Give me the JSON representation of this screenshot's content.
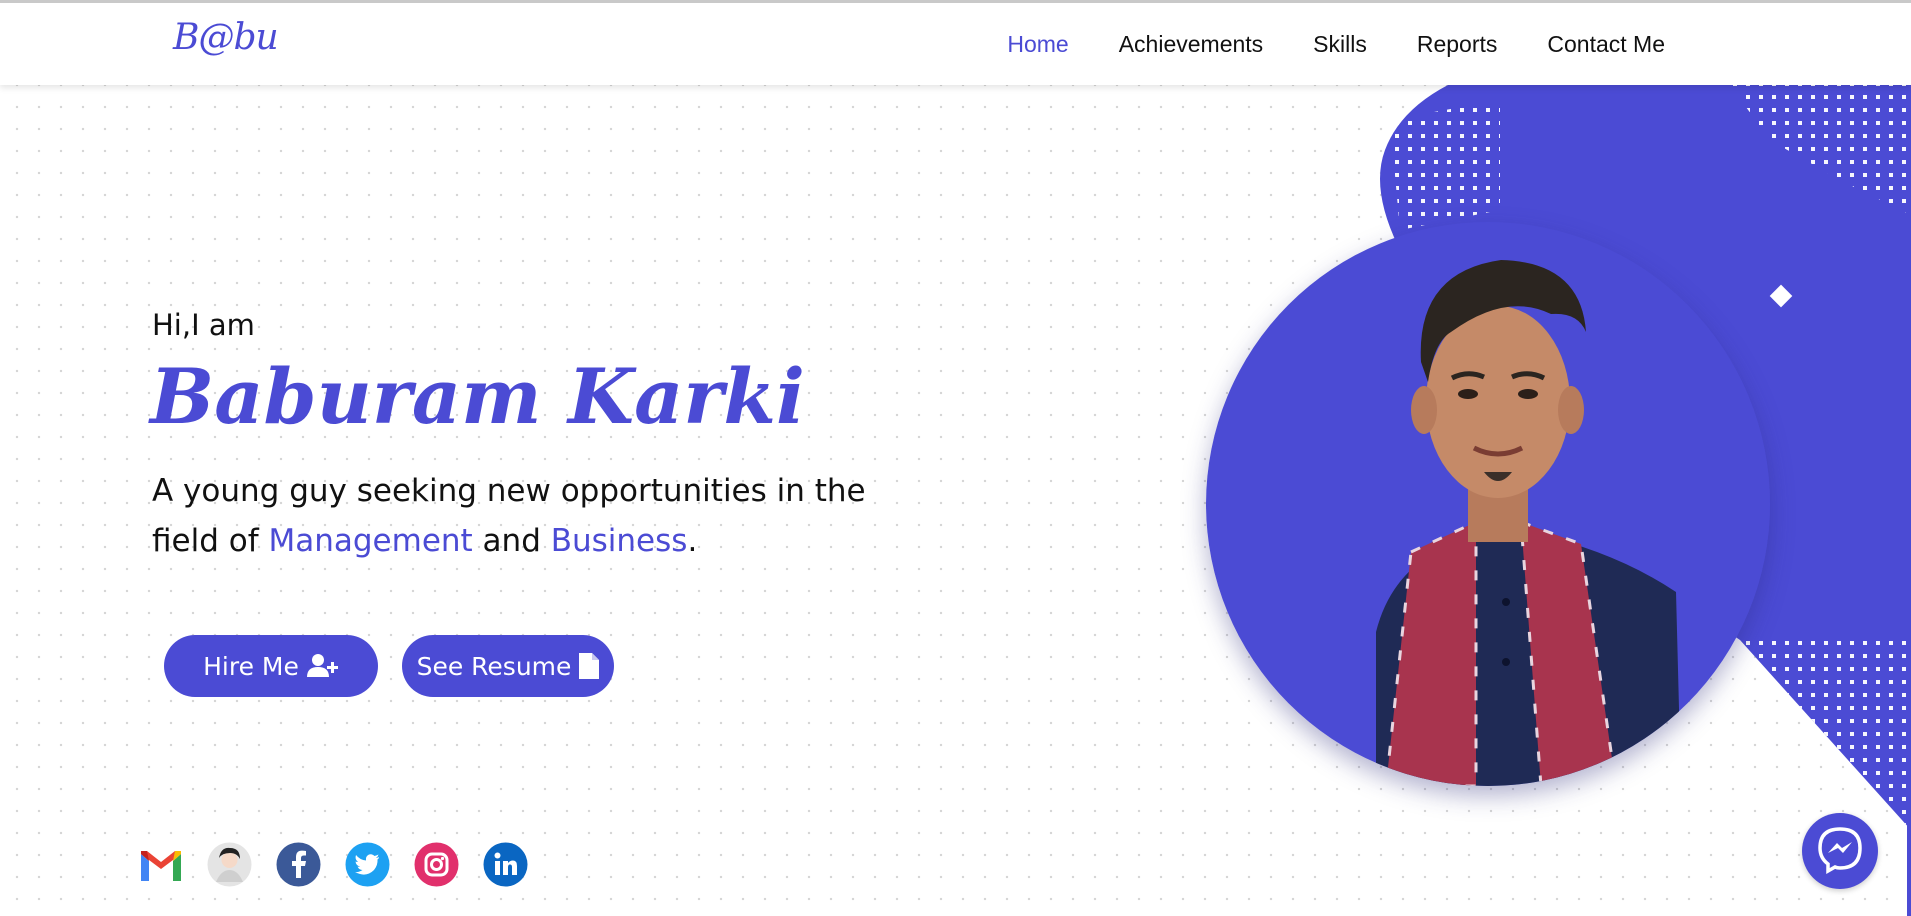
{
  "brand": {
    "logo": "B@bu"
  },
  "nav": {
    "items": [
      {
        "label": "Home",
        "active": true
      },
      {
        "label": "Achievements",
        "active": false
      },
      {
        "label": "Skills",
        "active": false
      },
      {
        "label": "Reports",
        "active": false
      },
      {
        "label": "Contact Me",
        "active": false
      }
    ]
  },
  "hero": {
    "greeting": "Hi,I am",
    "name": "Baburam Karki",
    "tagline_part1": "A young guy seeking new opportunities in the field of ",
    "highlight1": "Management",
    "tagline_part2": " and ",
    "highlight2": "Business",
    "tagline_end": ".",
    "buttons": {
      "hire": "Hire Me",
      "resume": "See Resume"
    }
  },
  "socials": [
    {
      "icon": "gmail-icon"
    },
    {
      "icon": "avatar-icon"
    },
    {
      "icon": "facebook-icon"
    },
    {
      "icon": "twitter-icon"
    },
    {
      "icon": "instagram-icon"
    },
    {
      "icon": "linkedin-icon"
    }
  ],
  "colors": {
    "accent": "#4b4bd4",
    "facebook": "#3b5998",
    "twitter": "#1da1f2",
    "instagram": "#e1306c",
    "linkedin": "#0a66c2"
  },
  "chat_widget": {
    "icon": "messenger-icon"
  }
}
